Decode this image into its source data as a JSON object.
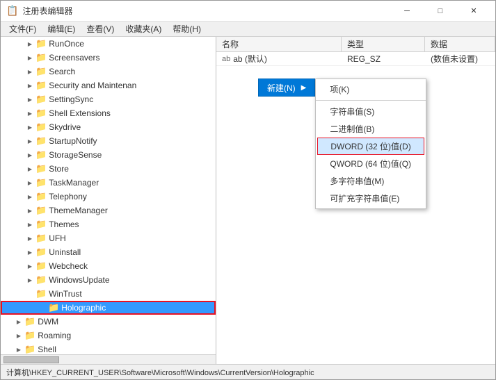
{
  "window": {
    "title": "注册表编辑器",
    "minimize_label": "─",
    "maximize_label": "□",
    "close_label": "✕"
  },
  "menu": {
    "items": [
      "文件(F)",
      "编辑(E)",
      "查看(V)",
      "收藏夹(A)",
      "帮助(H)"
    ]
  },
  "tree": {
    "items": [
      {
        "label": "RunOnce",
        "indent": "indent-2",
        "arrow": "collapsed"
      },
      {
        "label": "Screensavers",
        "indent": "indent-2",
        "arrow": "collapsed"
      },
      {
        "label": "Search",
        "indent": "indent-2",
        "arrow": "collapsed"
      },
      {
        "label": "Security and Maintenan",
        "indent": "indent-2",
        "arrow": "collapsed"
      },
      {
        "label": "SettingSync",
        "indent": "indent-2",
        "arrow": "collapsed"
      },
      {
        "label": "Shell Extensions",
        "indent": "indent-2",
        "arrow": "collapsed"
      },
      {
        "label": "Skydrive",
        "indent": "indent-2",
        "arrow": "collapsed"
      },
      {
        "label": "StartupNotify",
        "indent": "indent-2",
        "arrow": "collapsed"
      },
      {
        "label": "StorageSense",
        "indent": "indent-2",
        "arrow": "collapsed"
      },
      {
        "label": "Store",
        "indent": "indent-2",
        "arrow": "collapsed"
      },
      {
        "label": "TaskManager",
        "indent": "indent-2",
        "arrow": "collapsed"
      },
      {
        "label": "Telephony",
        "indent": "indent-2",
        "arrow": "collapsed"
      },
      {
        "label": "ThemeManager",
        "indent": "indent-2",
        "arrow": "collapsed"
      },
      {
        "label": "Themes",
        "indent": "indent-2",
        "arrow": "collapsed"
      },
      {
        "label": "UFH",
        "indent": "indent-2",
        "arrow": "collapsed"
      },
      {
        "label": "Uninstall",
        "indent": "indent-2",
        "arrow": "collapsed"
      },
      {
        "label": "Webcheck",
        "indent": "indent-2",
        "arrow": "collapsed"
      },
      {
        "label": "WindowsUpdate",
        "indent": "indent-2",
        "arrow": "collapsed"
      },
      {
        "label": "WinTrust",
        "indent": "indent-2",
        "arrow": "collapsed"
      },
      {
        "label": "Holographic",
        "indent": "indent-3",
        "arrow": "collapsed",
        "selected": true
      },
      {
        "label": "DWM",
        "indent": "indent-1",
        "arrow": "collapsed"
      },
      {
        "label": "Roaming",
        "indent": "indent-1",
        "arrow": "collapsed"
      },
      {
        "label": "Shell",
        "indent": "indent-1",
        "arrow": "collapsed"
      }
    ]
  },
  "reg_table": {
    "headers": [
      "名称",
      "类型",
      "数据"
    ],
    "rows": [
      {
        "name": "ab (默认)",
        "type": "REG_SZ",
        "data": "(数值未设置)"
      }
    ]
  },
  "context_menu": {
    "new_label": "新建(N)",
    "arrow": "▶",
    "items": [
      {
        "label": "项(K)",
        "highlighted": false
      },
      {
        "label": "字符串值(S)",
        "highlighted": false
      },
      {
        "label": "二进制值(B)",
        "highlighted": false
      },
      {
        "label": "DWORD (32 位)值(D)",
        "highlighted": true
      },
      {
        "label": "QWORD (64 位)值(Q)",
        "highlighted": false
      },
      {
        "label": "多字符串值(M)",
        "highlighted": false
      },
      {
        "label": "可扩充字符串值(E)",
        "highlighted": false
      }
    ]
  },
  "status_bar": {
    "text": "计算机\\HKEY_CURRENT_USER\\Software\\Microsoft\\Windows\\CurrentVersion\\Holographic"
  }
}
